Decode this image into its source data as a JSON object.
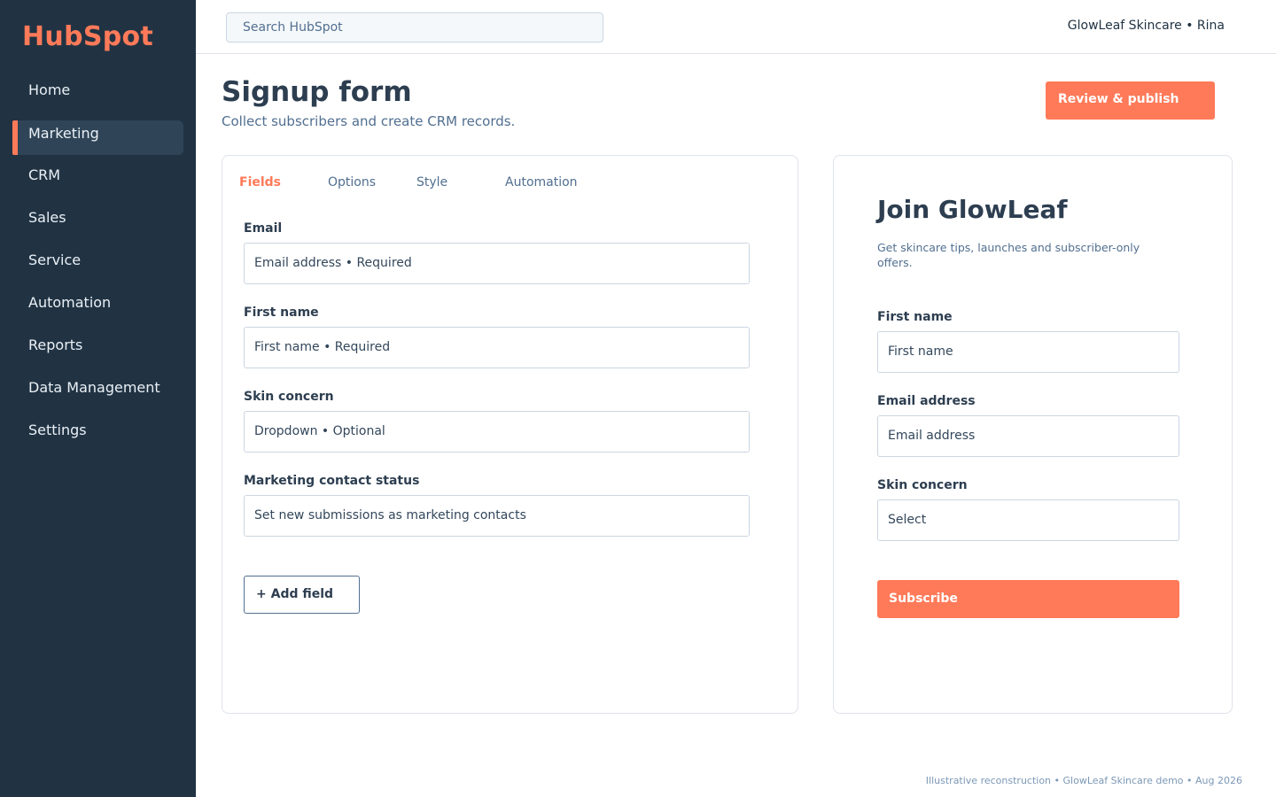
{
  "app": {
    "logo": "HubSpot"
  },
  "sidebar": {
    "items": [
      {
        "label": "Home"
      },
      {
        "label": "Marketing",
        "active": true
      },
      {
        "label": "CRM"
      },
      {
        "label": "Sales"
      },
      {
        "label": "Service"
      },
      {
        "label": "Automation"
      },
      {
        "label": "Reports"
      },
      {
        "label": "Data Management"
      },
      {
        "label": "Settings"
      }
    ]
  },
  "topbar": {
    "search_placeholder": "Search HubSpot",
    "account": "GlowLeaf Skincare  •  Rina"
  },
  "header": {
    "title": "Signup form",
    "subtitle": "Collect subscribers and create CRM records.",
    "primary_action": "Review & publish"
  },
  "editor": {
    "tabs": [
      {
        "label": "Fields",
        "active": true
      },
      {
        "label": "Options"
      },
      {
        "label": "Style"
      },
      {
        "label": "Automation"
      }
    ],
    "fields": [
      {
        "label": "Email",
        "value": "Email address • Required"
      },
      {
        "label": "First name",
        "value": "First name • Required"
      },
      {
        "label": "Skin concern",
        "value": "Dropdown • Optional"
      },
      {
        "label": "Marketing contact status",
        "value": "Set new submissions as marketing contacts"
      }
    ],
    "add_field_label": "+ Add field"
  },
  "preview": {
    "title": "Join GlowLeaf",
    "description": "Get skincare tips, launches and subscriber-only offers.",
    "fields": [
      {
        "label": "First name",
        "placeholder": "First name"
      },
      {
        "label": "Email address",
        "placeholder": "Email address"
      },
      {
        "label": "Skin concern",
        "placeholder": "Select"
      }
    ],
    "submit_label": "Subscribe"
  },
  "footer": {
    "note": "Illustrative reconstruction • GlowLeaf Skincare demo • Aug 2026"
  },
  "colors": {
    "accent": "#ff7a59",
    "sidebar_bg": "#213343",
    "sidebar_active_bg": "#2f4457",
    "text_primary": "#2d3e50",
    "text_secondary": "#516f90",
    "border": "#cbd6e2"
  }
}
